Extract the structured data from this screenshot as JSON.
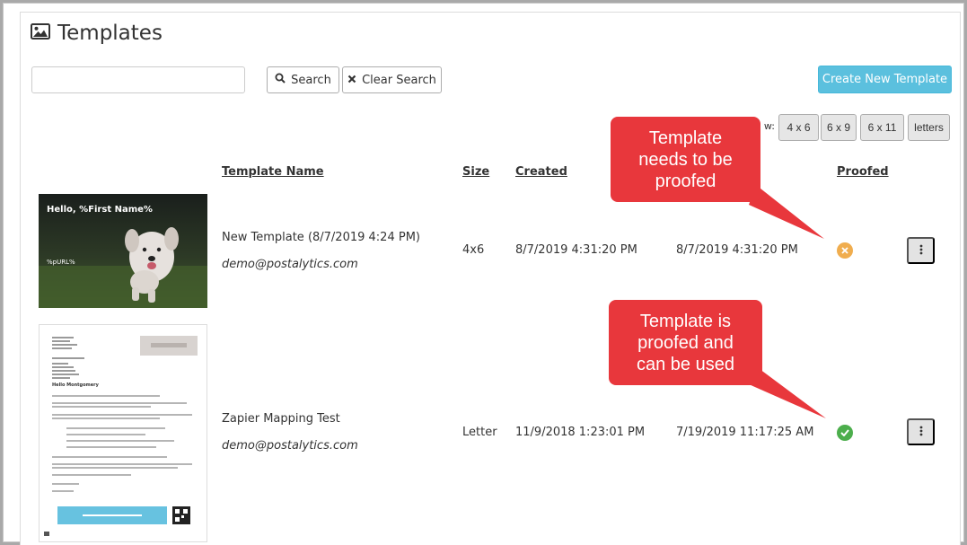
{
  "header": {
    "title": "Templates"
  },
  "toolbar": {
    "search_value": "",
    "search_label": "Search",
    "clear_label": "Clear Search",
    "create_label": "Create New Template"
  },
  "size_filter": {
    "label_partial": "w:",
    "options": [
      "4 x 6",
      "6 x 9",
      "6 x 11",
      "letters"
    ]
  },
  "columns": {
    "name": "Template Name",
    "size": "Size",
    "created": "Created",
    "proofed": "Proofed"
  },
  "rows": [
    {
      "name": "New Template (8/7/2019 4:24 PM)",
      "email": "demo@postalytics.com",
      "size": "4x6",
      "created": "8/7/2019 4:31:20 PM",
      "modified": "8/7/2019 4:31:20 PM",
      "proofed": false,
      "thumb_greeting": "Hello, %First Name%",
      "thumb_purl": "%pURL%"
    },
    {
      "name": "Zapier Mapping Test",
      "email": "demo@postalytics.com",
      "size": "Letter",
      "created": "11/9/2018 1:23:01 PM",
      "modified": "7/19/2019 11:17:25 AM",
      "proofed": true,
      "thumb_salutation": "Hello Montgomery"
    }
  ],
  "callouts": {
    "not_proofed": "Template\nneeds to be\nproofed",
    "proofed": "Template is\nproofed and\ncan be used"
  },
  "colors": {
    "accent": "#5bc0de",
    "callout": "#e8373c",
    "not_proofed": "#f0ad4e",
    "proofed": "#4cae4c"
  }
}
